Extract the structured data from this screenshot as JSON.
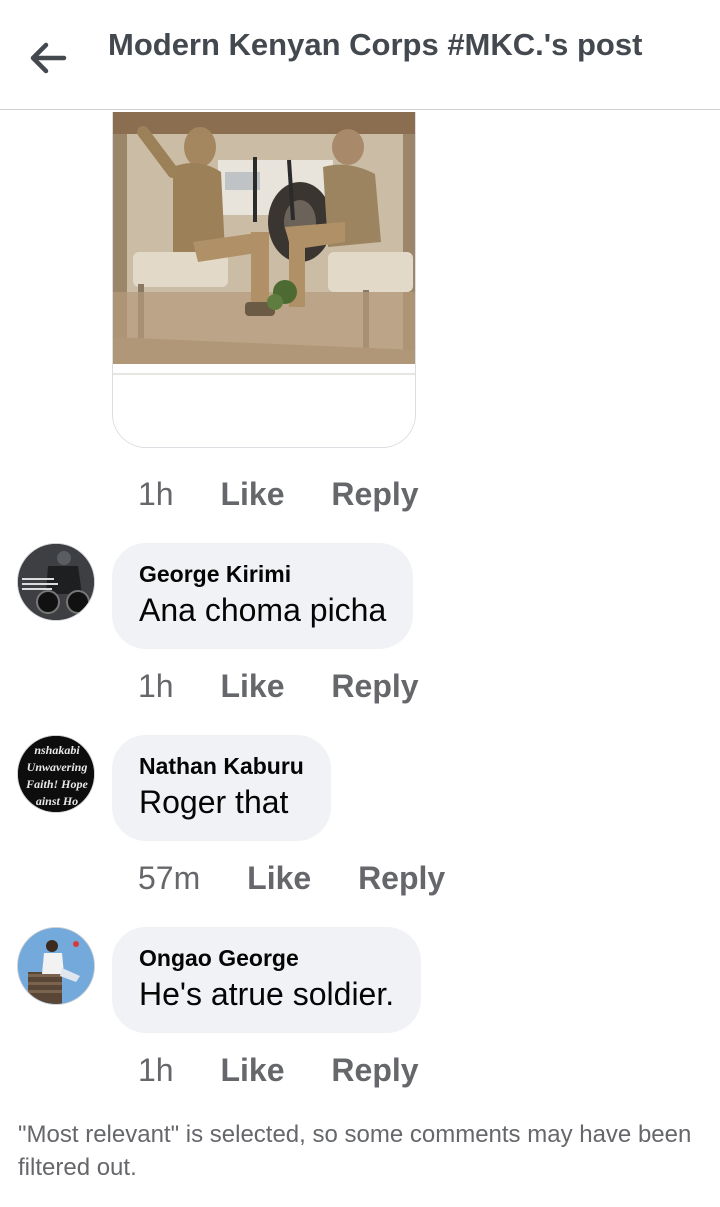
{
  "header": {
    "title": "Modern Kenyan Corps #MKC.'s post"
  },
  "photo_comment": {
    "time": "1h",
    "like_label": "Like",
    "reply_label": "Reply"
  },
  "comments": [
    {
      "author": "George Kirimi",
      "text": "Ana choma picha",
      "time": "1h",
      "like_label": "Like",
      "reply_label": "Reply"
    },
    {
      "author": "Nathan Kaburu",
      "text": "Roger that",
      "time": "57m",
      "like_label": "Like",
      "reply_label": "Reply",
      "avatar_lines": [
        "nshakabi",
        "Unwavering",
        "Faith! Hope",
        "ainst Ho"
      ]
    },
    {
      "author": "Ongao George",
      "text": "He's atrue soldier.",
      "time": "1h",
      "like_label": "Like",
      "reply_label": "Reply"
    }
  ],
  "footer": {
    "note": "\"Most relevant\" is selected, so some comments may have been filtered out."
  },
  "icons": {
    "back": "back-arrow-icon"
  },
  "colors": {
    "meta_text": "#65676b",
    "bubble_bg": "#f0f2f5",
    "title_text": "#444950"
  }
}
